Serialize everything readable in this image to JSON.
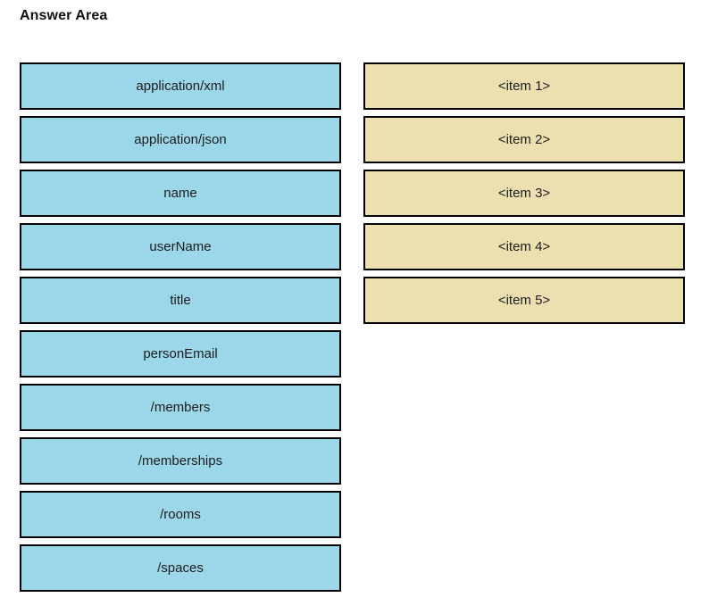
{
  "header": {
    "title": "Answer Area"
  },
  "colors": {
    "source_fill": "#9BD7E9",
    "target_fill": "#EDE0B0",
    "border": "#000000",
    "text": "#1c1c1c",
    "background": "#ffffff"
  },
  "source_column": {
    "name": "draggable-options",
    "items": [
      {
        "label": "application/xml"
      },
      {
        "label": "application/json"
      },
      {
        "label": "name"
      },
      {
        "label": "userName"
      },
      {
        "label": "title"
      },
      {
        "label": "personEmail"
      },
      {
        "label": "/members"
      },
      {
        "label": "/memberships"
      },
      {
        "label": "/rooms"
      },
      {
        "label": "/spaces"
      }
    ]
  },
  "target_column": {
    "name": "drop-targets",
    "items": [
      {
        "label": "<item 1>"
      },
      {
        "label": "<item 2>"
      },
      {
        "label": "<item 3>"
      },
      {
        "label": "<item 4>"
      },
      {
        "label": "<item 5>"
      }
    ]
  }
}
